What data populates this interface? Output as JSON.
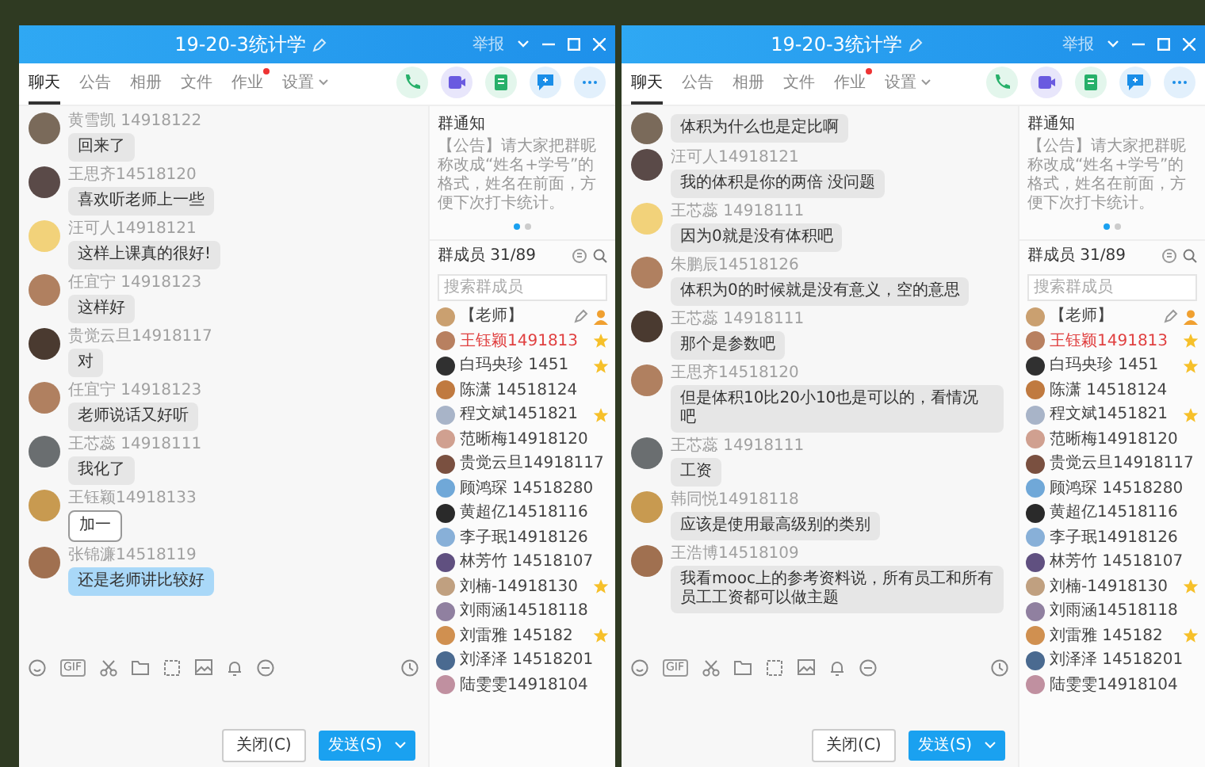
{
  "windows": [
    {
      "title": "19-20-3统计学",
      "report": "举报",
      "tabs": [
        {
          "label": "聊天",
          "selected": true,
          "dot": false,
          "dropdown": false
        },
        {
          "label": "公告",
          "selected": false,
          "dot": false,
          "dropdown": false
        },
        {
          "label": "相册",
          "selected": false,
          "dot": false,
          "dropdown": false
        },
        {
          "label": "文件",
          "selected": false,
          "dot": false,
          "dropdown": false
        },
        {
          "label": "作业",
          "selected": false,
          "dot": true,
          "dropdown": false
        },
        {
          "label": "设置",
          "selected": false,
          "dot": false,
          "dropdown": true
        }
      ],
      "messages": [
        {
          "sender": "黄雪凯 14918122",
          "text": "回来了",
          "kind": "plain"
        },
        {
          "sender": "王思齐14518120",
          "text": "喜欢听老师上一些",
          "kind": "plain"
        },
        {
          "sender": "汪可人14918121",
          "text": "这样上课真的很好!",
          "kind": "plain"
        },
        {
          "sender": "任宜宁 14918123",
          "text": "这样好",
          "kind": "plain"
        },
        {
          "sender": "贵觉云旦14918117",
          "text": "对",
          "kind": "plain"
        },
        {
          "sender": "任宜宁 14918123",
          "text": "老师说话又好听",
          "kind": "plain"
        },
        {
          "sender": "王芯蕊 14918111",
          "text": "我化了",
          "kind": "plain"
        },
        {
          "sender": "王钰颖14918133",
          "text": "加一",
          "kind": "framed"
        },
        {
          "sender": "张锦濂14518119",
          "text": "还是老师讲比较好",
          "kind": "blue"
        }
      ],
      "gif": "GIF",
      "close_button": "关闭(C)",
      "send_button": "发送(S)",
      "notice": {
        "title": "群通知",
        "text": "【公告】请大家把群昵称改成“姓名+学号”的格式，姓名在前面，方便下次打卡统计。"
      },
      "members_title": "群成员 31/89",
      "member_search": {
        "placeholder": "搜索群成员"
      },
      "members": [
        {
          "name": "【老师】",
          "kind": "teacher",
          "highlighted": false,
          "starred": false
        },
        {
          "name": "王钰颖1491813",
          "kind": "student",
          "highlighted": true,
          "starred": true
        },
        {
          "name": "白玛央珍 1451",
          "kind": "student",
          "highlighted": false,
          "starred": true
        },
        {
          "name": "陈潇 14518124",
          "kind": "student",
          "highlighted": false,
          "starred": false
        },
        {
          "name": "程文斌1451821",
          "kind": "student",
          "highlighted": false,
          "starred": true
        },
        {
          "name": "范晰梅14918120",
          "kind": "student",
          "highlighted": false,
          "starred": false
        },
        {
          "name": "贵觉云旦14918117",
          "kind": "student",
          "highlighted": false,
          "starred": false
        },
        {
          "name": "顾鸿琛 14518280",
          "kind": "student",
          "highlighted": false,
          "starred": false
        },
        {
          "name": "黄超亿14518116",
          "kind": "student",
          "highlighted": false,
          "starred": false
        },
        {
          "name": "李子珉14918126",
          "kind": "student",
          "highlighted": false,
          "starred": false
        },
        {
          "name": "林芳竹 14518107",
          "kind": "student",
          "highlighted": false,
          "starred": false
        },
        {
          "name": "刘楠-14918130",
          "kind": "student",
          "highlighted": false,
          "starred": true
        },
        {
          "name": "刘雨涵14518118",
          "kind": "student",
          "highlighted": false,
          "starred": false
        },
        {
          "name": "刘雷雅 145182",
          "kind": "student",
          "highlighted": false,
          "starred": true
        },
        {
          "name": "刘泽泽 14518201",
          "kind": "student",
          "highlighted": false,
          "starred": false
        },
        {
          "name": "陆雯雯14918104",
          "kind": "student",
          "highlighted": false,
          "starred": false
        }
      ]
    },
    {
      "title": "19-20-3统计学",
      "report": "举报",
      "tabs": [
        {
          "label": "聊天",
          "selected": true,
          "dot": false,
          "dropdown": false
        },
        {
          "label": "公告",
          "selected": false,
          "dot": false,
          "dropdown": false
        },
        {
          "label": "相册",
          "selected": false,
          "dot": false,
          "dropdown": false
        },
        {
          "label": "文件",
          "selected": false,
          "dot": false,
          "dropdown": false
        },
        {
          "label": "作业",
          "selected": false,
          "dot": true,
          "dropdown": false
        },
        {
          "label": "设置",
          "selected": false,
          "dot": false,
          "dropdown": true
        }
      ],
      "messages": [
        {
          "text": "体积为什么也是定比啊",
          "kind": "plain"
        },
        {
          "sender": "汪可人14918121",
          "text": "我的体积是你的两倍 没问题",
          "kind": "plain"
        },
        {
          "sender": "王芯蕊 14918111",
          "text": "因为0就是没有体积吧",
          "kind": "plain"
        },
        {
          "sender": "朱鹏辰14518126",
          "text": "体积为0的时候就是没有意义，空的意思",
          "kind": "plain"
        },
        {
          "sender": "王芯蕊 14918111",
          "text": "那个是参数吧",
          "kind": "plain"
        },
        {
          "sender": "王思齐14518120",
          "text": "但是体积10比20小10也是可以的，看情况吧",
          "kind": "plain"
        },
        {
          "sender": "王芯蕊 14918111",
          "text": "工资",
          "kind": "plain"
        },
        {
          "sender": "韩同悦14918118",
          "text": "应该是使用最高级别的类别",
          "kind": "plain"
        },
        {
          "sender": "王浩博14518109",
          "text": "我看mooc上的参考资料说，所有员工和所有员工工资都可以做主题",
          "kind": "plain"
        }
      ],
      "gif": "GIF",
      "close_button": "关闭(C)",
      "send_button": "发送(S)",
      "notice": {
        "title": "群通知",
        "text": "【公告】请大家把群昵称改成“姓名+学号”的格式，姓名在前面，方便下次打卡统计。"
      },
      "members_title": "群成员 31/89",
      "member_search": {
        "placeholder": "搜索群成员"
      },
      "members": [
        {
          "name": "【老师】",
          "kind": "teacher",
          "highlighted": false,
          "starred": false
        },
        {
          "name": "王钰颖1491813",
          "kind": "student",
          "highlighted": true,
          "starred": true
        },
        {
          "name": "白玛央珍 1451",
          "kind": "student",
          "highlighted": false,
          "starred": true
        },
        {
          "name": "陈潇 14518124",
          "kind": "student",
          "highlighted": false,
          "starred": false
        },
        {
          "name": "程文斌1451821",
          "kind": "student",
          "highlighted": false,
          "starred": true
        },
        {
          "name": "范晰梅14918120",
          "kind": "student",
          "highlighted": false,
          "starred": false
        },
        {
          "name": "贵觉云旦14918117",
          "kind": "student",
          "highlighted": false,
          "starred": false
        },
        {
          "name": "顾鸿琛 14518280",
          "kind": "student",
          "highlighted": false,
          "starred": false
        },
        {
          "name": "黄超亿14518116",
          "kind": "student",
          "highlighted": false,
          "starred": false
        },
        {
          "name": "李子珉14918126",
          "kind": "student",
          "highlighted": false,
          "starred": false
        },
        {
          "name": "林芳竹 14518107",
          "kind": "student",
          "highlighted": false,
          "starred": false
        },
        {
          "name": "刘楠-14918130",
          "kind": "student",
          "highlighted": false,
          "starred": true
        },
        {
          "name": "刘雨涵14518118",
          "kind": "student",
          "highlighted": false,
          "starred": false
        },
        {
          "name": "刘雷雅 145182",
          "kind": "student",
          "highlighted": false,
          "starred": true
        },
        {
          "name": "刘泽泽 14518201",
          "kind": "student",
          "highlighted": false,
          "starred": false
        },
        {
          "name": "陆雯雯14918104",
          "kind": "student",
          "highlighted": false,
          "starred": false
        }
      ]
    }
  ]
}
